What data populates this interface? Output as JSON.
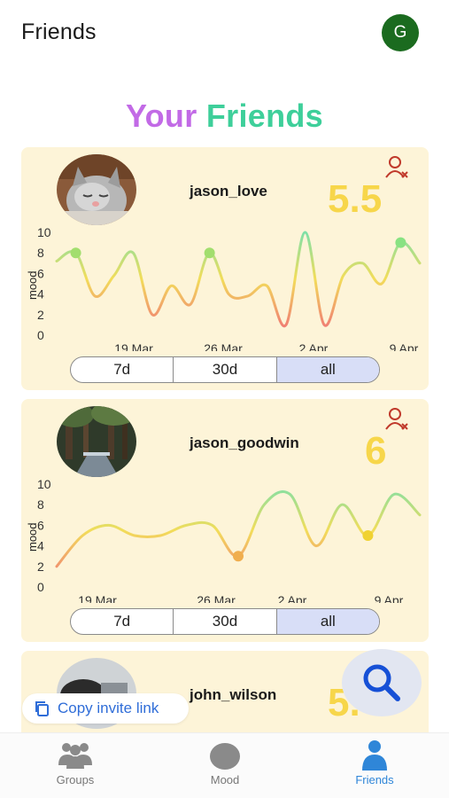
{
  "topbar": {
    "title": "Friends",
    "avatar_letter": "G"
  },
  "heading": {
    "part1": "Your",
    "part2": "Friends"
  },
  "segment_options": [
    "7d",
    "30d",
    "all"
  ],
  "friends": [
    {
      "username": "jason_love",
      "score": "5.5",
      "chart_data": {
        "type": "line",
        "ylabel": "mood",
        "ylim": [
          0,
          10
        ],
        "yticks": [
          "10",
          "8",
          "6",
          "4",
          "2",
          "0"
        ],
        "xticks": [
          "19 Mar",
          "26 Mar",
          "2 Apr",
          "9 Apr"
        ],
        "series": [
          {
            "values": [
              7.2,
              8.0,
              3.8,
              5.8,
              8.0,
              2.0,
              4.8,
              3.0,
              8.0,
              4.0,
              3.8,
              4.8,
              1.0,
              10.0,
              1.0,
              5.8,
              7.0,
              5.0,
              9.0,
              7.0
            ]
          }
        ],
        "highlight_points": [
          1,
          8,
          18
        ]
      }
    },
    {
      "username": "jason_goodwin",
      "score": "6",
      "chart_data": {
        "type": "line",
        "ylabel": "mood",
        "ylim": [
          0,
          10
        ],
        "yticks": [
          "10",
          "8",
          "6",
          "4",
          "2",
          "0"
        ],
        "xticks": [
          "19 Mar",
          "26 Mar",
          "2 Apr",
          "9 Apr"
        ],
        "series": [
          {
            "values": [
              2.0,
              5.0,
              6.0,
              5.0,
              5.0,
              6.0,
              6.0,
              3.0,
              8.0,
              9.0,
              4.0,
              8.0,
              5.0,
              9.0,
              7.0
            ]
          }
        ],
        "highlight_points": [
          7,
          12
        ]
      }
    },
    {
      "username": "john_wilson",
      "score": "5."
    }
  ],
  "copy_invite_label": "Copy invite link",
  "nav": {
    "groups": "Groups",
    "mood": "Mood",
    "friends": "Friends"
  },
  "colors": {
    "accent": "#2f86d8",
    "card_bg": "#fdf4d8",
    "score": "#f7d64a"
  }
}
